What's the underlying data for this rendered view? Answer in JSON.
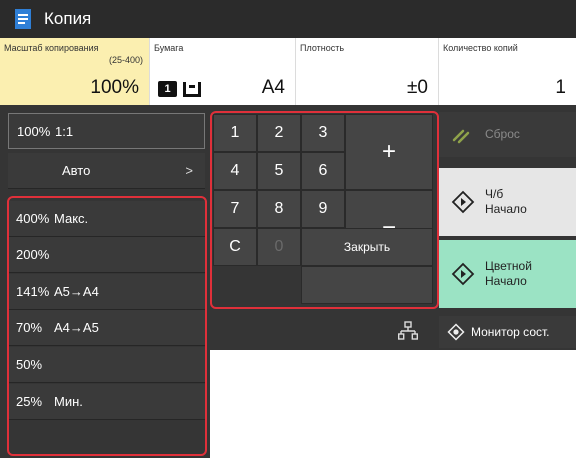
{
  "header": {
    "title": "Копия",
    "app_icon": "document-icon"
  },
  "settings": {
    "scale": {
      "label": "Масштаб копирования",
      "range": "(25-400)",
      "value": "100%"
    },
    "paper": {
      "label": "Бумага",
      "tray_number": "1",
      "size": "A4"
    },
    "density": {
      "label": "Плотность",
      "value": "±0"
    },
    "copies": {
      "label": "Количество копий",
      "value": "1"
    }
  },
  "scale_list": {
    "current": {
      "pct": "100%",
      "desc": "1:1"
    },
    "auto": {
      "label": "Авто",
      "arrow": ">"
    },
    "presets": [
      {
        "pct": "400%",
        "desc": "Макс."
      },
      {
        "pct": "200%",
        "desc": ""
      },
      {
        "pct": "141%",
        "desc": "A5→A4"
      },
      {
        "pct": "70%",
        "desc": "A4→A5"
      },
      {
        "pct": "50%",
        "desc": ""
      },
      {
        "pct": "25%",
        "desc": "Мин."
      }
    ]
  },
  "keypad": {
    "keys": [
      "1",
      "2",
      "3",
      "4",
      "5",
      "6",
      "7",
      "8",
      "9",
      "C",
      "0"
    ],
    "plus": "+",
    "minus": "−",
    "close": "Закрыть"
  },
  "actions": {
    "reset": "Сброс",
    "bw_start": "Ч/б\nНачало",
    "color_start": "Цветной\nНачало",
    "status_monitor": "Монитор сост."
  },
  "colors": {
    "highlight_frame": "#e0303a",
    "scale_active_bg": "#fbefb0",
    "color_start_bg": "#9be3c4",
    "dark_bg": "#353535"
  }
}
